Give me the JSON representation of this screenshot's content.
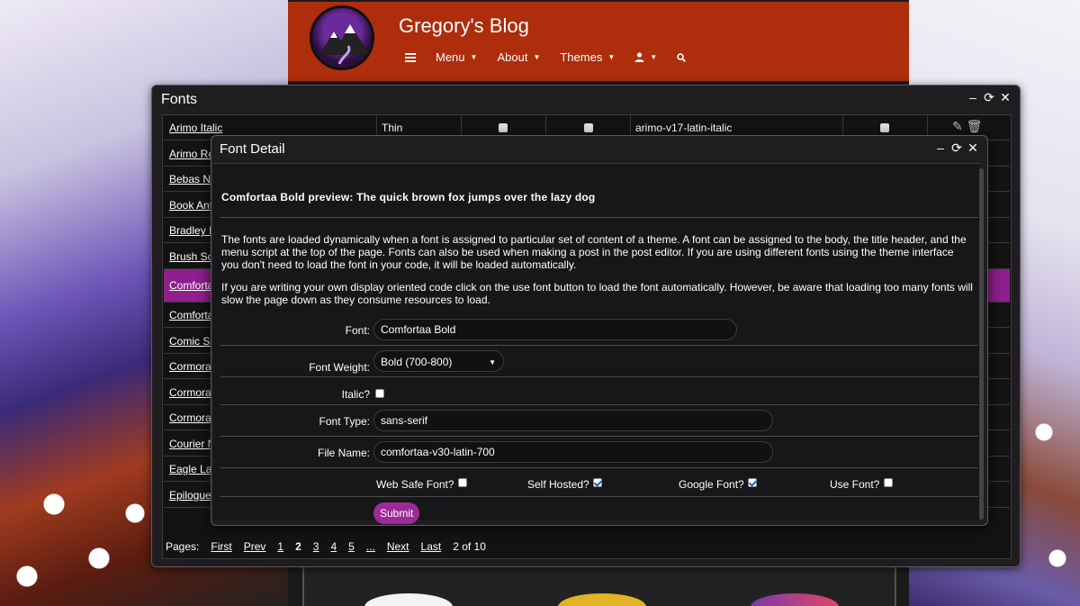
{
  "blog": {
    "title": "Gregory's Blog",
    "nav": {
      "menu_label": "Menu",
      "about_label": "About",
      "themes_label": "Themes"
    }
  },
  "fonts_window": {
    "title": "Fonts",
    "rows": [
      {
        "name": "Arimo Italic",
        "weight": "Thin",
        "file": "arimo-v17-latin-italic"
      },
      {
        "name": "Arimo Re"
      },
      {
        "name": "Bebas Ne"
      },
      {
        "name": "Book Ant"
      },
      {
        "name": "Bradley H"
      },
      {
        "name": "Brush Sc"
      },
      {
        "name": "Comforta"
      },
      {
        "name": "Comforta"
      },
      {
        "name": "Comic Sa"
      },
      {
        "name": "Cormora"
      },
      {
        "name": "Cormora"
      },
      {
        "name": "Cormora"
      },
      {
        "name": "Courier N"
      },
      {
        "name": "Eagle La"
      },
      {
        "name": "Epilogue"
      }
    ],
    "pager": {
      "label": "Pages:",
      "first": "First",
      "prev": "Prev",
      "pages": [
        "1",
        "2",
        "3",
        "4",
        "5",
        "..."
      ],
      "current": "2",
      "next": "Next",
      "last": "Last",
      "status": "2 of 10"
    }
  },
  "detail": {
    "title": "Font Detail",
    "preview": "Comfortaa Bold preview: The quick brown fox jumps over the lazy dog",
    "para1": "The fonts are loaded dynamically when a font is assigned to particular set of content of a theme. A font can be assigned to the body, the title header, and the menu script at the top of the page. Fonts can also be used when making a post in the post editor. If you are using different fonts using the theme interface you don't need to load the font in your code, it will be loaded automatically.",
    "para2": "If you are writing your own display oriented code click on the use font button to load the font automatically. However, be aware that loading too many fonts will slow the page down as they consume resources to load.",
    "font_label": "Font:",
    "font_value": "Comfortaa Bold",
    "weight_label": "Font Weight:",
    "weight_value": "Bold (700-800)",
    "italic_label": "Italic?",
    "type_label": "Font Type:",
    "type_value": "sans-serif",
    "file_label": "File Name:",
    "file_value": "comfortaa-v30-latin-700",
    "websafe_label": "Web Safe Font?",
    "selfhosted_label": "Self Hosted?",
    "google_label": "Google Font?",
    "usefont_label": "Use Font?",
    "submit_label": "Submit"
  },
  "colors": {
    "header_bg": "#ad2d0c",
    "accent": "#8e1f8c",
    "window_bg": "#1f1d20"
  }
}
